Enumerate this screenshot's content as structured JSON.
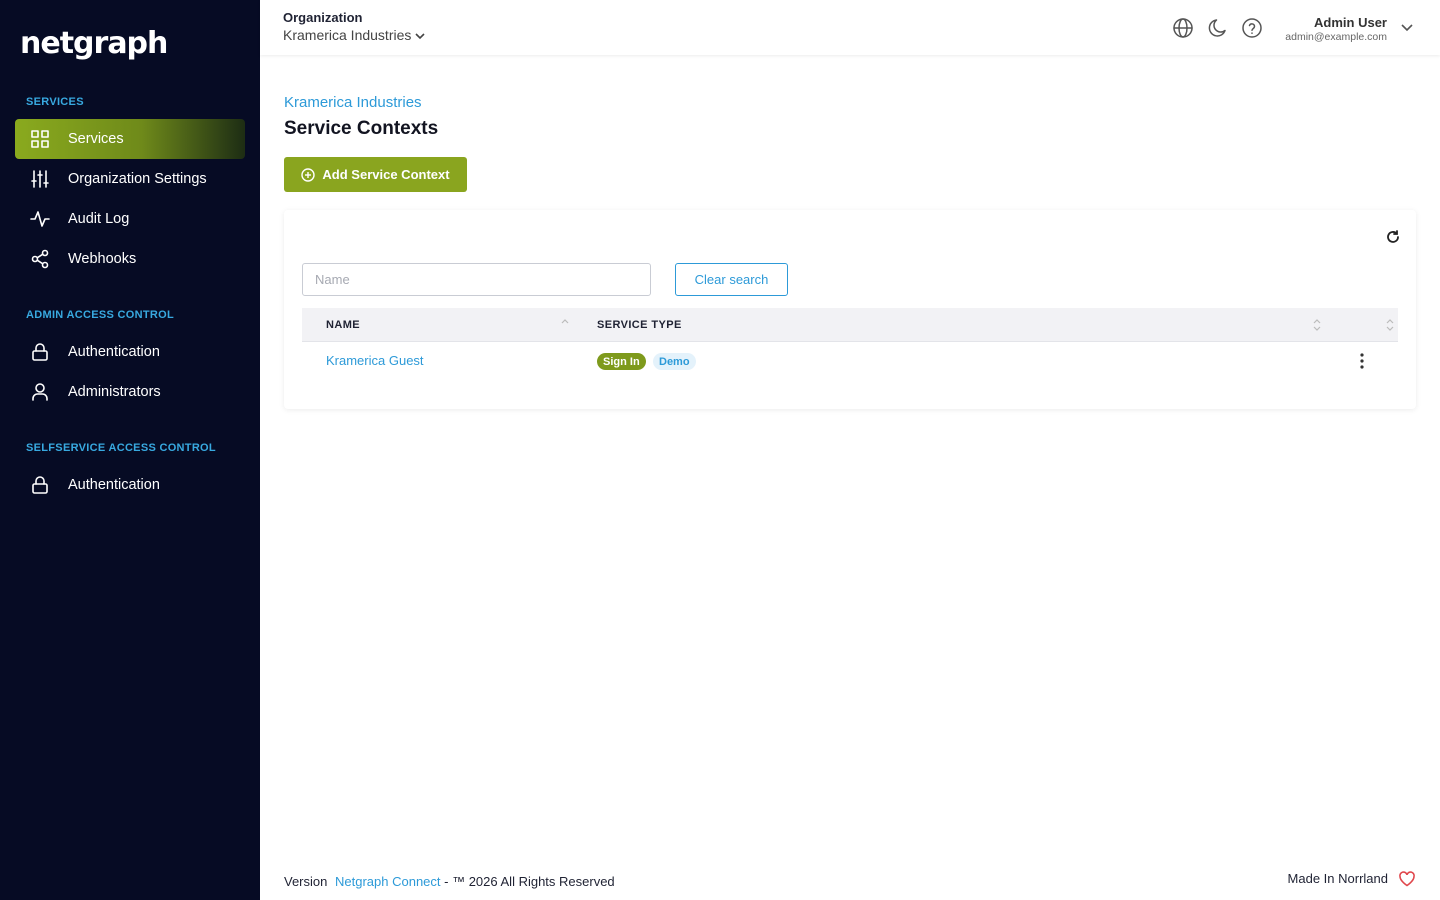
{
  "sidebar": {
    "logo": "netgraph",
    "sections": [
      {
        "title": "SERVICES"
      },
      {
        "title": "ADMIN ACCESS CONTROL"
      },
      {
        "title": "SELFSERVICE ACCESS CONTROL"
      }
    ],
    "items": [
      {
        "label": "Services",
        "icon": "grid-icon",
        "active": true
      },
      {
        "label": "Organization Settings",
        "icon": "sliders-icon"
      },
      {
        "label": "Audit Log",
        "icon": "activity-icon"
      },
      {
        "label": "Webhooks",
        "icon": "share-icon"
      },
      {
        "label": "Authentication",
        "icon": "lock-icon"
      },
      {
        "label": "Administrators",
        "icon": "user-icon"
      },
      {
        "label": "Authentication",
        "icon": "lock-icon"
      }
    ]
  },
  "header": {
    "org_label": "Organization",
    "org_value": "Kramerica Industries",
    "user_name": "Admin User",
    "user_email": "admin@example.com"
  },
  "main": {
    "breadcrumb": "Kramerica Industries",
    "title": "Service Contexts",
    "add_button": "Add Service Context",
    "search_placeholder": "Name",
    "clear_button": "Clear search",
    "columns": [
      "NAME",
      "SERVICE TYPE"
    ],
    "rows": [
      {
        "name": "Kramerica Guest",
        "badges": [
          "Sign In",
          "Demo"
        ]
      }
    ]
  },
  "footer": {
    "version_prefix": "Version",
    "product_link": "Netgraph Connect",
    "rights": "- ™ 2026 All Rights Reserved",
    "made_in": "Made In Norrland"
  },
  "colors": {
    "sidebar_bg": "#060b24",
    "accent_green": "#8aa51f",
    "link_blue": "#2d9ad8",
    "heart_red": "#e0474c"
  }
}
